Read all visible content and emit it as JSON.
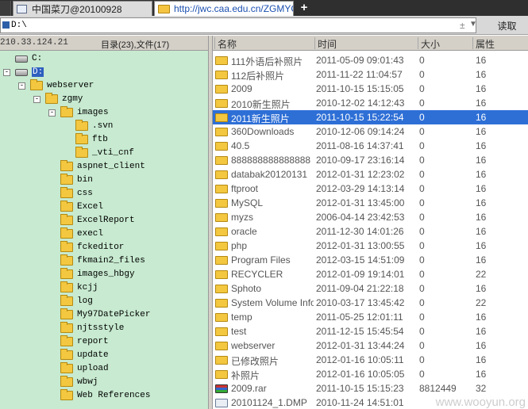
{
  "tabs": [
    {
      "label": ""
    },
    {
      "label": "中国菜刀@20100928"
    },
    {
      "label": "http://jwc.caa.edu.cn/ZGMYC"
    }
  ],
  "tab_new_label": "+",
  "tab_close": "×",
  "address": {
    "value": "D:\\",
    "up_symbol": "±",
    "dropdown_symbol": "▼",
    "read_button": "读取"
  },
  "left_header": {
    "ip": "210.33.124.21",
    "counts": "目录(23),文件(17)"
  },
  "tree": [
    {
      "label": "C:",
      "indent": 0,
      "toggle": "",
      "icon": "drive",
      "selected": false
    },
    {
      "label": "D:",
      "indent": 0,
      "toggle": "-",
      "icon": "drive",
      "selected": true
    },
    {
      "label": "webserver",
      "indent": 1,
      "toggle": "-",
      "icon": "folder",
      "selected": false
    },
    {
      "label": "zgmy",
      "indent": 2,
      "toggle": "-",
      "icon": "folder",
      "selected": false
    },
    {
      "label": "images",
      "indent": 3,
      "toggle": "-",
      "icon": "folder",
      "selected": false
    },
    {
      "label": ".svn",
      "indent": 4,
      "toggle": "",
      "icon": "folder",
      "selected": false
    },
    {
      "label": "ftb",
      "indent": 4,
      "toggle": "",
      "icon": "folder",
      "selected": false
    },
    {
      "label": "_vti_cnf",
      "indent": 4,
      "toggle": "",
      "icon": "folder",
      "selected": false
    },
    {
      "label": "aspnet_client",
      "indent": 3,
      "toggle": "",
      "icon": "folder",
      "selected": false
    },
    {
      "label": "bin",
      "indent": 3,
      "toggle": "",
      "icon": "folder",
      "selected": false
    },
    {
      "label": "css",
      "indent": 3,
      "toggle": "",
      "icon": "folder",
      "selected": false
    },
    {
      "label": "Excel",
      "indent": 3,
      "toggle": "",
      "icon": "folder",
      "selected": false
    },
    {
      "label": "ExcelReport",
      "indent": 3,
      "toggle": "",
      "icon": "folder",
      "selected": false
    },
    {
      "label": "execl",
      "indent": 3,
      "toggle": "",
      "icon": "folder",
      "selected": false
    },
    {
      "label": "fckeditor",
      "indent": 3,
      "toggle": "",
      "icon": "folder",
      "selected": false
    },
    {
      "label": "fkmain2_files",
      "indent": 3,
      "toggle": "",
      "icon": "folder",
      "selected": false
    },
    {
      "label": "images_hbgy",
      "indent": 3,
      "toggle": "",
      "icon": "folder",
      "selected": false
    },
    {
      "label": "kcjj",
      "indent": 3,
      "toggle": "",
      "icon": "folder",
      "selected": false
    },
    {
      "label": "log",
      "indent": 3,
      "toggle": "",
      "icon": "folder",
      "selected": false
    },
    {
      "label": "My97DatePicker",
      "indent": 3,
      "toggle": "",
      "icon": "folder",
      "selected": false
    },
    {
      "label": "njtsstyle",
      "indent": 3,
      "toggle": "",
      "icon": "folder",
      "selected": false
    },
    {
      "label": "report",
      "indent": 3,
      "toggle": "",
      "icon": "folder",
      "selected": false
    },
    {
      "label": "update",
      "indent": 3,
      "toggle": "",
      "icon": "folder",
      "selected": false
    },
    {
      "label": "upload",
      "indent": 3,
      "toggle": "",
      "icon": "folder",
      "selected": false
    },
    {
      "label": "wbwj",
      "indent": 3,
      "toggle": "",
      "icon": "folder",
      "selected": false
    },
    {
      "label": "Web References",
      "indent": 3,
      "toggle": "",
      "icon": "folder",
      "selected": false
    }
  ],
  "file_columns": {
    "name": "名称",
    "time": "时间",
    "size": "大小",
    "attr": "属性"
  },
  "files": [
    {
      "name": "111外语后补照片",
      "time": "2011-05-09 09:01:43",
      "size": "0",
      "attr": "16",
      "icon": "folder",
      "selected": false
    },
    {
      "name": "112后补照片",
      "time": "2011-11-22 11:04:57",
      "size": "0",
      "attr": "16",
      "icon": "folder",
      "selected": false
    },
    {
      "name": "2009",
      "time": "2011-10-15 15:15:05",
      "size": "0",
      "attr": "16",
      "icon": "folder",
      "selected": false
    },
    {
      "name": "2010新生照片",
      "time": "2010-12-02 14:12:43",
      "size": "0",
      "attr": "16",
      "icon": "folder",
      "selected": false
    },
    {
      "name": "2011新生照片",
      "time": "2011-10-15 15:22:54",
      "size": "0",
      "attr": "16",
      "icon": "folder",
      "selected": true
    },
    {
      "name": "360Downloads",
      "time": "2010-12-06 09:14:24",
      "size": "0",
      "attr": "16",
      "icon": "folder",
      "selected": false
    },
    {
      "name": "40.5",
      "time": "2011-08-16 14:37:41",
      "size": "0",
      "attr": "16",
      "icon": "folder",
      "selected": false
    },
    {
      "name": "888888888888888",
      "time": "2010-09-17 23:16:14",
      "size": "0",
      "attr": "16",
      "icon": "folder",
      "selected": false
    },
    {
      "name": "databak20120131",
      "time": "2012-01-31 12:23:02",
      "size": "0",
      "attr": "16",
      "icon": "folder",
      "selected": false
    },
    {
      "name": "ftproot",
      "time": "2012-03-29 14:13:14",
      "size": "0",
      "attr": "16",
      "icon": "folder",
      "selected": false
    },
    {
      "name": "MySQL",
      "time": "2012-01-31 13:45:00",
      "size": "0",
      "attr": "16",
      "icon": "folder",
      "selected": false
    },
    {
      "name": "myzs",
      "time": "2006-04-14 23:42:53",
      "size": "0",
      "attr": "16",
      "icon": "folder",
      "selected": false
    },
    {
      "name": "oracle",
      "time": "2011-12-30 14:01:26",
      "size": "0",
      "attr": "16",
      "icon": "folder",
      "selected": false
    },
    {
      "name": "php",
      "time": "2012-01-31 13:00:55",
      "size": "0",
      "attr": "16",
      "icon": "folder",
      "selected": false
    },
    {
      "name": "Program Files",
      "time": "2012-03-15 14:51:09",
      "size": "0",
      "attr": "16",
      "icon": "folder",
      "selected": false
    },
    {
      "name": "RECYCLER",
      "time": "2012-01-09 19:14:01",
      "size": "0",
      "attr": "22",
      "icon": "folder",
      "selected": false
    },
    {
      "name": "Sphoto",
      "time": "2011-09-04 21:22:18",
      "size": "0",
      "attr": "16",
      "icon": "folder",
      "selected": false
    },
    {
      "name": "System Volume Information",
      "time": "2010-03-17 13:45:42",
      "size": "0",
      "attr": "22",
      "icon": "folder",
      "selected": false
    },
    {
      "name": "temp",
      "time": "2011-05-25 12:01:11",
      "size": "0",
      "attr": "16",
      "icon": "folder",
      "selected": false
    },
    {
      "name": "test",
      "time": "2011-12-15 15:45:54",
      "size": "0",
      "attr": "16",
      "icon": "folder",
      "selected": false
    },
    {
      "name": "webserver",
      "time": "2012-01-31 13:44:24",
      "size": "0",
      "attr": "16",
      "icon": "folder",
      "selected": false
    },
    {
      "name": "已修改照片",
      "time": "2012-01-16 10:05:11",
      "size": "0",
      "attr": "16",
      "icon": "folder",
      "selected": false
    },
    {
      "name": "补照片",
      "time": "2012-01-16 10:05:05",
      "size": "0",
      "attr": "16",
      "icon": "folder",
      "selected": false
    },
    {
      "name": "2009.rar",
      "time": "2011-10-15 15:15:23",
      "size": "8812449",
      "attr": "32",
      "icon": "archive",
      "selected": false
    },
    {
      "name": "20101124_1.DMP",
      "time": "2010-11-24 14:51:01",
      "size": "",
      "attr": "",
      "icon": "doc",
      "selected": false
    }
  ],
  "watermark": "www.wooyun.org",
  "colors": {
    "tree_bg": "#c7ead0",
    "selection": "#2e6fd6",
    "folder": "#f3c73f"
  }
}
